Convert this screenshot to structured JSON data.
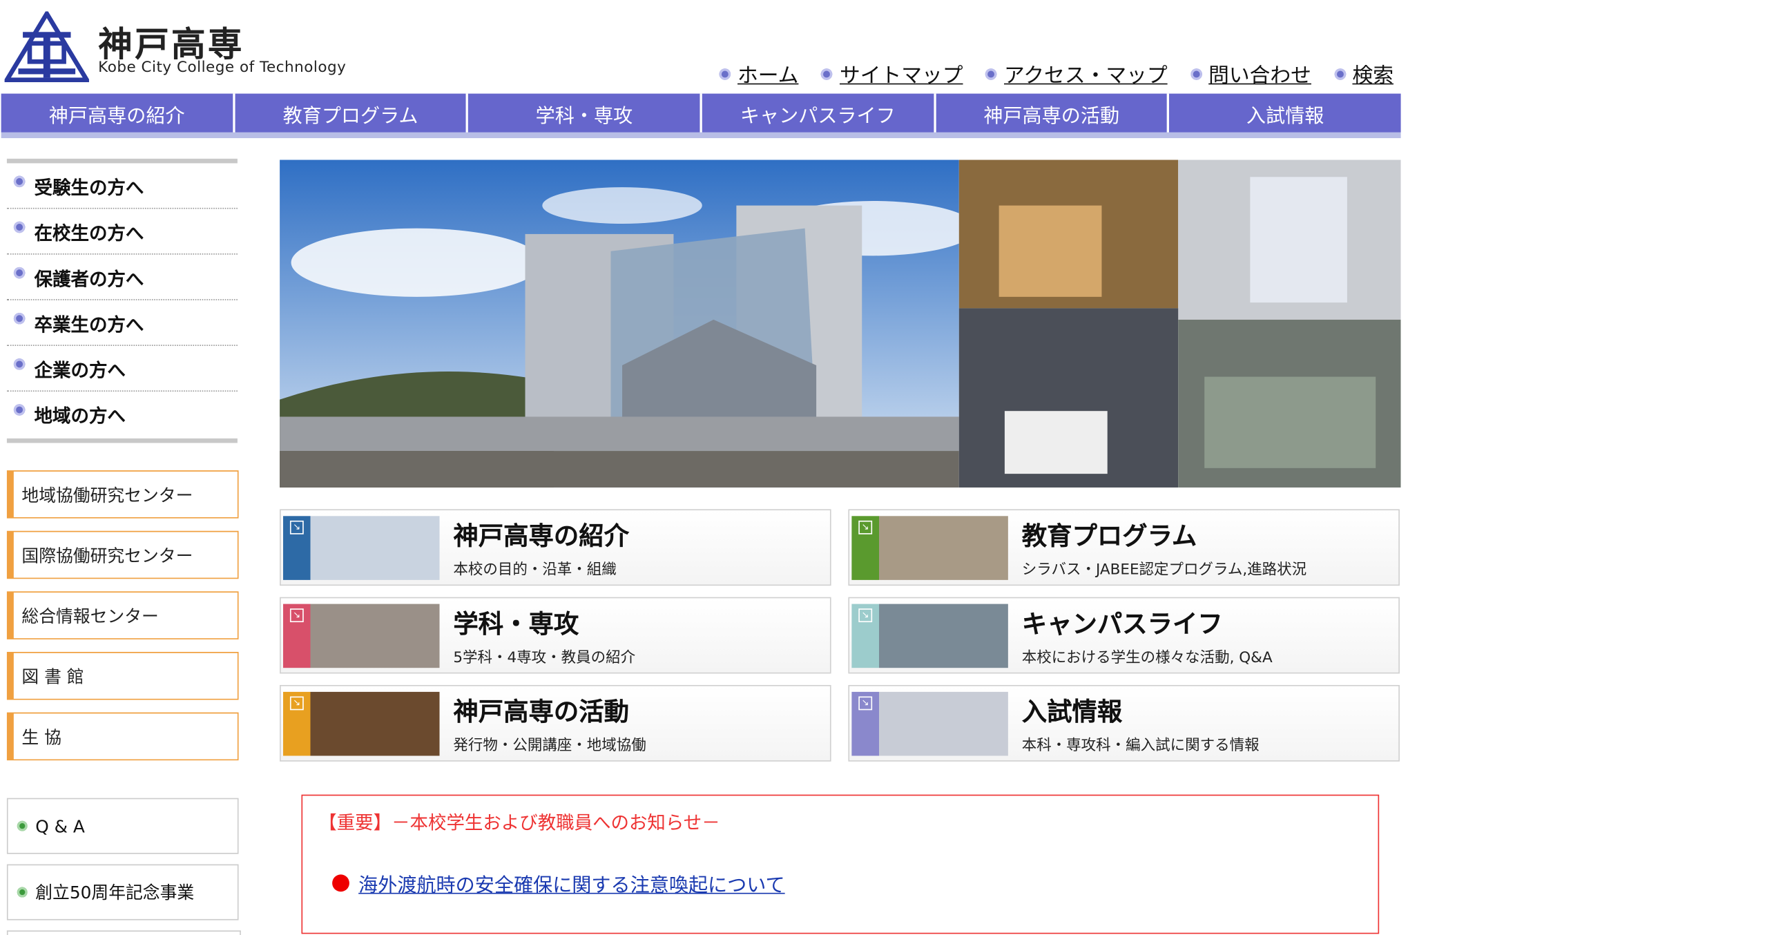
{
  "logo": {
    "name_jp": "神戸高専",
    "name_en": "Kobe City College of Technology",
    "mark_text": "高"
  },
  "utility_nav": [
    "ホーム",
    "サイトマップ",
    "アクセス・マップ",
    "問い合わせ",
    "検索"
  ],
  "main_nav": [
    "神戸高専の紹介",
    "教育プログラム",
    "学科・専攻",
    "キャンパスライフ",
    "神戸高専の活動",
    "入試情報"
  ],
  "sidebar": {
    "audience": [
      "受験生の方へ",
      "在校生の方へ",
      "保護者の方へ",
      "卒業生の方へ",
      "企業の方へ",
      "地域の方へ"
    ],
    "centers": [
      "地域協働研究センター",
      "国際協働研究センター",
      "総合情報センター",
      "図 書 館",
      "生 協"
    ],
    "extras": [
      "Q & A",
      "創立50周年記念事業"
    ]
  },
  "tiles": [
    {
      "title": "神戸高専の紹介",
      "sub": "本校の目的・沿革・組織",
      "accent": "#2d6aa6"
    },
    {
      "title": "教育プログラム",
      "sub": "シラバス・JABEE認定プログラム,進路状況",
      "accent": "#5a9a2e"
    },
    {
      "title": "学科・専攻",
      "sub": "5学科・4専攻・教員の紹介",
      "accent": "#d8506a"
    },
    {
      "title": "キャンパスライフ",
      "sub": "本校における学生の様々な活動, Q&A",
      "accent": "#9ccccc"
    },
    {
      "title": "神戸高専の活動",
      "sub": "発行物・公開講座・地域協働",
      "accent": "#e8a020"
    },
    {
      "title": "入試情報",
      "sub": "本科・専攻科・編入試に関する情報",
      "accent": "#8a88cc"
    }
  ],
  "notice": {
    "heading": "【重要】－本校学生および教職員へのお知らせ－",
    "link": "海外渡航時の安全確保に関する注意喚起について"
  },
  "colors": {
    "nav": "#6666cc",
    "nav_bottom": "#b8bde6",
    "accent_orange": "#f0a040",
    "notice_red": "#ee3333",
    "link_blue": "#1a3ab0"
  }
}
